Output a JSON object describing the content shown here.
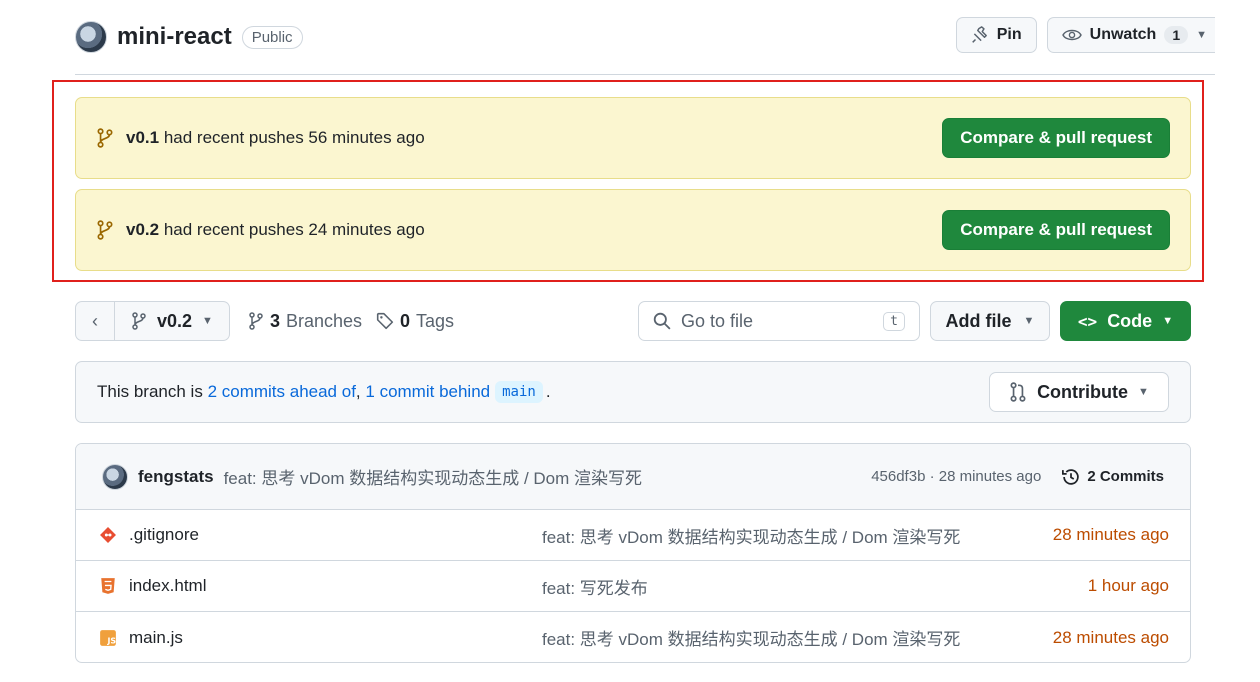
{
  "repo": {
    "name": "mini-react",
    "visibility": "Public",
    "pin_label": "Pin",
    "unwatch_label": "Unwatch",
    "watch_count": "1"
  },
  "banners": [
    {
      "branch": "v0.1",
      "text": "had recent pushes 56 minutes ago",
      "button": "Compare & pull request"
    },
    {
      "branch": "v0.2",
      "text": "had recent pushes 24 minutes ago",
      "button": "Compare & pull request"
    }
  ],
  "branch_bar": {
    "current_branch": "v0.2",
    "branches_count": "3",
    "branches_label": "Branches",
    "tags_count": "0",
    "tags_label": "Tags",
    "goto_placeholder": "Go to file",
    "goto_shortcut": "t",
    "add_file_label": "Add file",
    "code_label": "Code"
  },
  "ahead_behind": {
    "prefix": "This branch is",
    "ahead": "2 commits ahead of",
    "sep": ",",
    "behind": "1 commit behind",
    "base": "main",
    "suffix": ".",
    "contribute_label": "Contribute"
  },
  "latest_commit": {
    "author": "fengstats",
    "message": "feat: 思考 vDom 数据结构实现动态生成 / Dom 渲染写死",
    "sha_time": "456df3b · 28 minutes ago",
    "commits_label": "2 Commits"
  },
  "files": [
    {
      "name": ".gitignore",
      "icon": "git-icon",
      "message": "feat: 思考 vDom 数据结构实现动态生成 / Dom 渲染写死",
      "time": "28 minutes ago"
    },
    {
      "name": "index.html",
      "icon": "html-icon",
      "message": "feat: 写死发布",
      "time": "1 hour ago"
    },
    {
      "name": "main.js",
      "icon": "js-icon",
      "message": "feat: 思考 vDom 数据结构实现动态生成 / Dom 渲染写死",
      "time": "28 minutes ago"
    }
  ],
  "colors": {
    "green": "#1f883d",
    "banner_bg": "#fbf6d0",
    "highlight": "#e0201c",
    "link": "#0969da",
    "time": "#bc4c00"
  }
}
